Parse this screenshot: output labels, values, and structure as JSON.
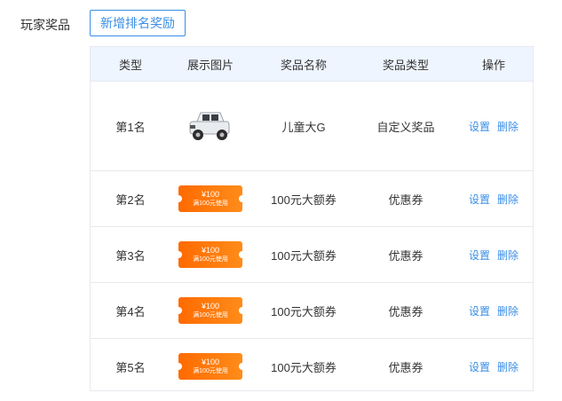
{
  "label": "玩家奖品",
  "add_button": "新增排名奖励",
  "table": {
    "headers": [
      "类型",
      "展示图片",
      "奖品名称",
      "奖品类型",
      "操作"
    ],
    "rows": [
      {
        "rank": "第1名",
        "image": "toy-car-image",
        "name": "儿童大G",
        "type": "自定义奖品",
        "set": "设置",
        "delete": "删除"
      },
      {
        "rank": "第2名",
        "image": "coupon",
        "coupon_amount": "¥100",
        "coupon_condition": "满100元使用",
        "name": "100元大额券",
        "type": "优惠券",
        "set": "设置",
        "delete": "删除"
      },
      {
        "rank": "第3名",
        "image": "coupon",
        "coupon_amount": "¥100",
        "coupon_condition": "满100元使用",
        "name": "100元大额券",
        "type": "优惠券",
        "set": "设置",
        "delete": "删除"
      },
      {
        "rank": "第4名",
        "image": "coupon",
        "coupon_amount": "¥100",
        "coupon_condition": "满100元使用",
        "name": "100元大额券",
        "type": "优惠券",
        "set": "设置",
        "delete": "删除"
      },
      {
        "rank": "第5名",
        "image": "coupon",
        "coupon_amount": "¥100",
        "coupon_condition": "满100元使用",
        "name": "100元大额券",
        "type": "优惠券",
        "set": "设置",
        "delete": "删除"
      }
    ]
  },
  "colors": {
    "accent": "#3a8ee6",
    "header_bg": "#eef5ff",
    "coupon": "#ff6a00"
  }
}
